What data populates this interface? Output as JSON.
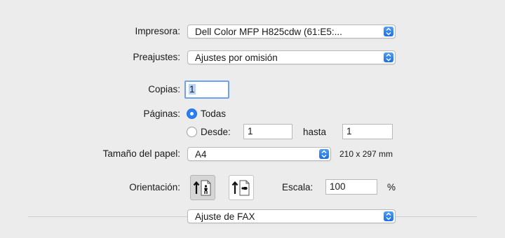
{
  "printer": {
    "label": "Impresora:",
    "value": "Dell Color MFP H825cdw (61:E5:..."
  },
  "presets": {
    "label": "Preajustes:",
    "value": "Ajustes por omisión"
  },
  "copies": {
    "label": "Copias:",
    "value": "1"
  },
  "pages": {
    "label": "Páginas:",
    "all_label": "Todas",
    "from_label": "Desde:",
    "from_value": "1",
    "to_label": "hasta",
    "to_value": "1",
    "selected": "all"
  },
  "paper_size": {
    "label": "Tamaño del papel:",
    "value": "A4",
    "dimensions": "210 x 297 mm"
  },
  "orientation": {
    "label": "Orientación:",
    "selected": "portrait",
    "options": [
      "portrait-icon",
      "landscape-icon"
    ]
  },
  "scale": {
    "label": "Escala:",
    "value": "100",
    "unit": "%"
  },
  "section_popup": {
    "value": "Ajuste de FAX"
  },
  "colors": {
    "accent": "#2a7ef0",
    "background": "#ececec"
  }
}
